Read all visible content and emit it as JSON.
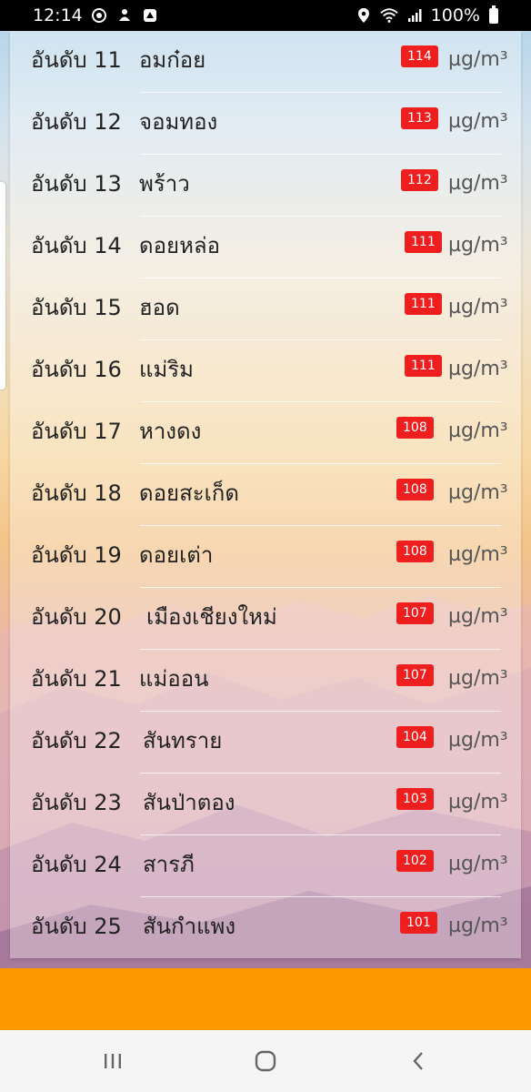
{
  "status_bar": {
    "time": "12:14",
    "battery": "100%",
    "icons_left": [
      "target-icon",
      "notification-icon",
      "app-icon"
    ],
    "icons_right": [
      "location-icon",
      "wifi-icon",
      "signal-icon",
      "battery-icon"
    ]
  },
  "list": {
    "rank_prefix": "อันดับ",
    "unit": "µg/m³",
    "badge_color": "#f01f1f",
    "rows": [
      {
        "rank": "อันดับ 11",
        "district": "อมก๋อย",
        "value": "114"
      },
      {
        "rank": "อันดับ 12",
        "district": "จอมทอง",
        "value": "113"
      },
      {
        "rank": "อันดับ 13",
        "district": "พร้าว",
        "value": "112"
      },
      {
        "rank": "อันดับ 14",
        "district": "ดอยหล่อ",
        "value": "111"
      },
      {
        "rank": "อันดับ 15",
        "district": "ฮอด",
        "value": "111"
      },
      {
        "rank": "อันดับ 16",
        "district": "แม่ริม",
        "value": "111"
      },
      {
        "rank": "อันดับ 17",
        "district": "หางดง",
        "value": "108"
      },
      {
        "rank": "อันดับ 18",
        "district": "ดอยสะเก็ด",
        "value": "108"
      },
      {
        "rank": "อันดับ 19",
        "district": "ดอยเต่า",
        "value": "108"
      },
      {
        "rank": "อันดับ 20",
        "district": "เมืองเชียงใหม่",
        "value": "107"
      },
      {
        "rank": "อันดับ 21",
        "district": "แม่ออน",
        "value": "107"
      },
      {
        "rank": "อันดับ 22",
        "district": "สันทราย",
        "value": "104"
      },
      {
        "rank": "อันดับ 23",
        "district": "สันป่าตอง",
        "value": "103"
      },
      {
        "rank": "อันดับ 24",
        "district": "สารภี",
        "value": "102"
      },
      {
        "rank": "อันดับ 25",
        "district": "สันกำแพง",
        "value": "101"
      }
    ]
  },
  "colors": {
    "accent_bar": "#ff9900",
    "status_bar": "#000000",
    "nav_bar": "#f5f5f5"
  },
  "nav_bar": {
    "buttons": [
      "recent-apps-icon",
      "home-icon",
      "back-icon"
    ]
  }
}
